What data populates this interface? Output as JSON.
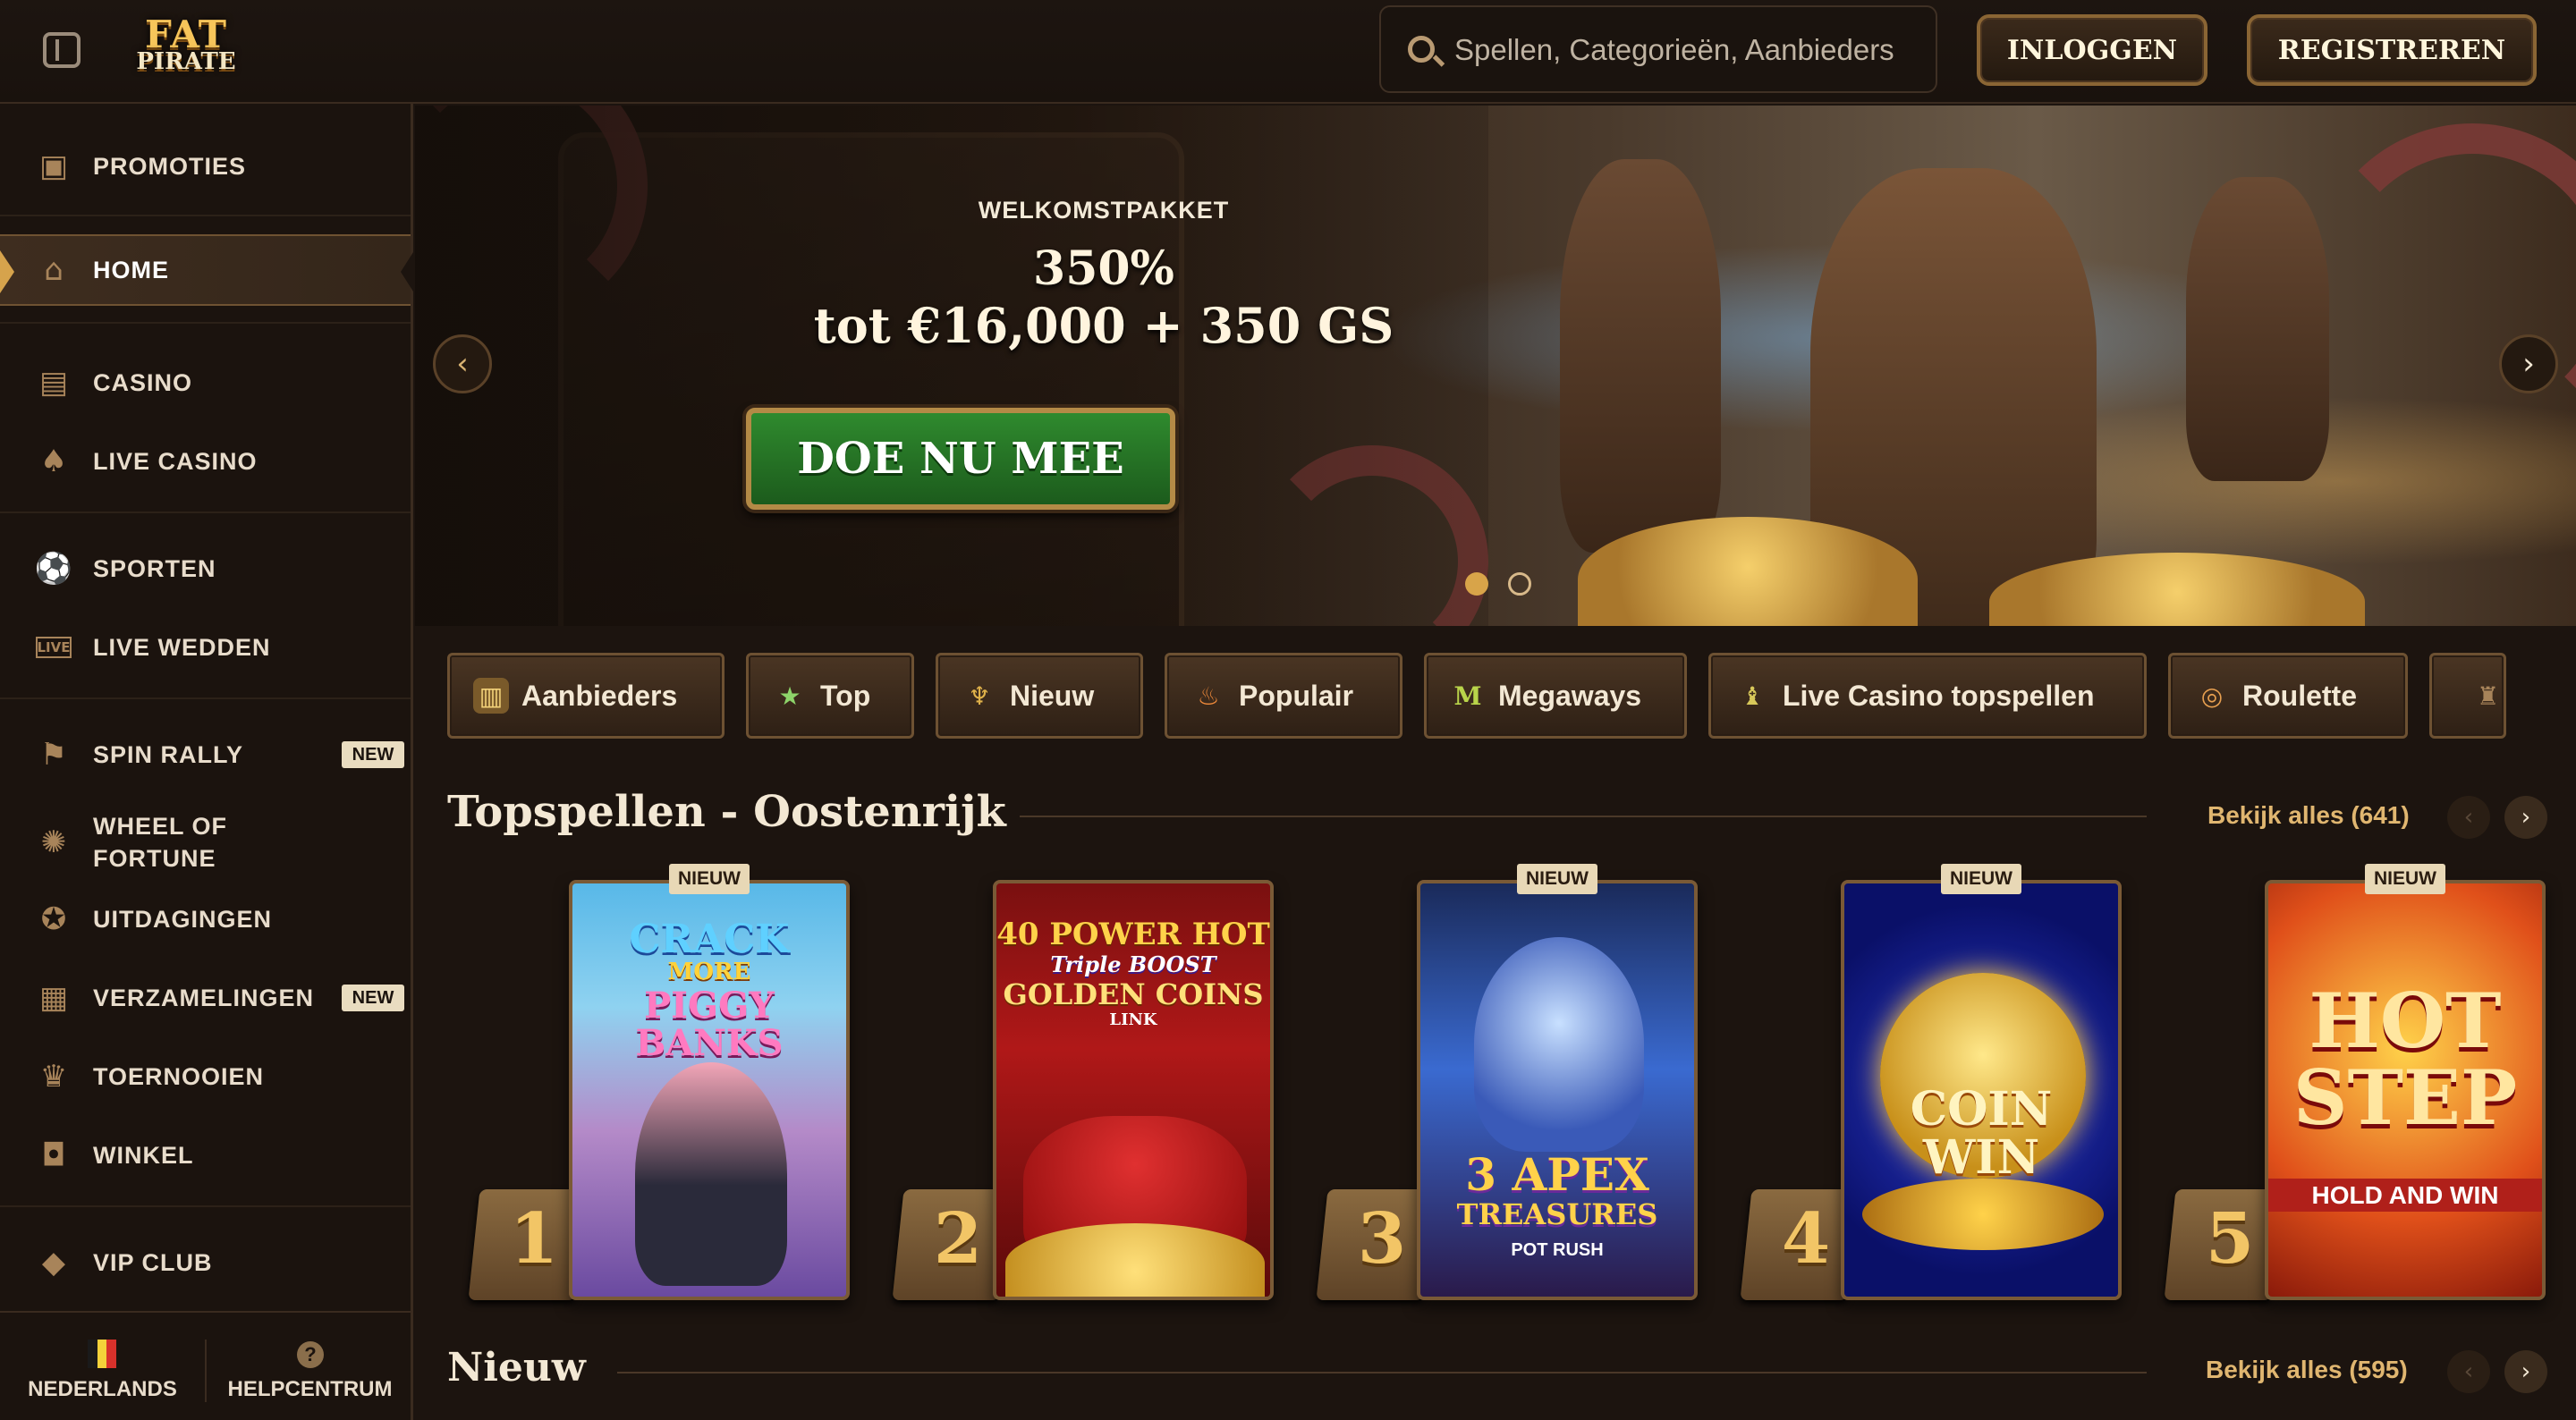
{
  "header": {
    "logo_line1": "FAT",
    "logo_line2": "PIRATE",
    "search_placeholder": "Spellen, Categorieën, Aanbieders",
    "login_label": "INLOGGEN",
    "register_label": "REGISTREREN"
  },
  "sidebar": {
    "items": [
      {
        "label": "PROMOTIES",
        "icon": "chest-icon"
      },
      {
        "label": "HOME",
        "icon": "home-icon",
        "active": true
      },
      {
        "label": "CASINO",
        "icon": "slot-machine-icon"
      },
      {
        "label": "LIVE CASINO",
        "icon": "cards-icon"
      },
      {
        "label": "SPORTEN",
        "icon": "soccer-ball-icon"
      },
      {
        "label": "LIVE WEDDEN",
        "icon": "live-icon",
        "icon_text": "LIVE"
      },
      {
        "label": "SPIN RALLY",
        "icon": "rally-flag-icon",
        "badge": "NEW"
      },
      {
        "label": "WHEEL OF FORTUNE",
        "icon": "wheel-icon"
      },
      {
        "label": "UITDAGINGEN",
        "icon": "medal-icon"
      },
      {
        "label": "VERZAMELINGEN",
        "icon": "collection-icon",
        "badge": "NEW"
      },
      {
        "label": "TOERNOOIEN",
        "icon": "trophy-icon"
      },
      {
        "label": "WINKEL",
        "icon": "shop-bag-icon"
      },
      {
        "label": "VIP CLUB",
        "icon": "diamond-icon"
      }
    ],
    "footer": {
      "language_label": "NEDERLANDS",
      "help_label": "HELPCENTRUM",
      "flag_colors": [
        "#1a1a1a",
        "#f4d23a",
        "#d8312b"
      ]
    }
  },
  "hero": {
    "subtitle": "WELKOMSTPAKKET",
    "line1": "350%",
    "line2": "tot €16,000 + 350 GS",
    "cta_label": "DOE NU MEE",
    "slide_count": 2,
    "active_slide": 1
  },
  "categories": [
    {
      "label": "Aanbieders",
      "icon": "map-icon"
    },
    {
      "label": "Top",
      "icon": "star-icon"
    },
    {
      "label": "Nieuw",
      "icon": "goblet-icon"
    },
    {
      "label": "Populair",
      "icon": "flame-icon"
    },
    {
      "label": "Megaways",
      "icon": "megaways-icon",
      "icon_text": "M"
    },
    {
      "label": "Live Casino topspellen",
      "icon": "torch-icon"
    },
    {
      "label": "Roulette",
      "icon": "roulette-icon"
    }
  ],
  "top_games": {
    "title": "Topspellen - Oostenrijk",
    "view_all": "Bekijk alles (641)",
    "games": [
      {
        "rank": "1",
        "tag": "NIEUW",
        "title_lines": [
          "CRACK",
          "MORE",
          "PIGGY BANKS"
        ]
      },
      {
        "rank": "2",
        "tag": "",
        "title_lines": [
          "40 POWER HOT",
          "Triple BOOST",
          "GOLDEN COINS",
          "LINK"
        ]
      },
      {
        "rank": "3",
        "tag": "NIEUW",
        "title_lines": [
          "3 APEX",
          "TREASURES",
          "POT RUSH"
        ]
      },
      {
        "rank": "4",
        "tag": "NIEUW",
        "title_lines": [
          "COIN",
          "WIN"
        ]
      },
      {
        "rank": "5",
        "tag": "NIEUW",
        "title_lines": [
          "HOT",
          "STEP",
          "HOLD AND WIN"
        ]
      }
    ]
  },
  "new_games": {
    "title": "Nieuw",
    "view_all": "Bekijk alles (595)"
  },
  "colors": {
    "background": "#1c140f",
    "accent_gold": "#e0b670",
    "cta_green": "#2f8a2e"
  }
}
